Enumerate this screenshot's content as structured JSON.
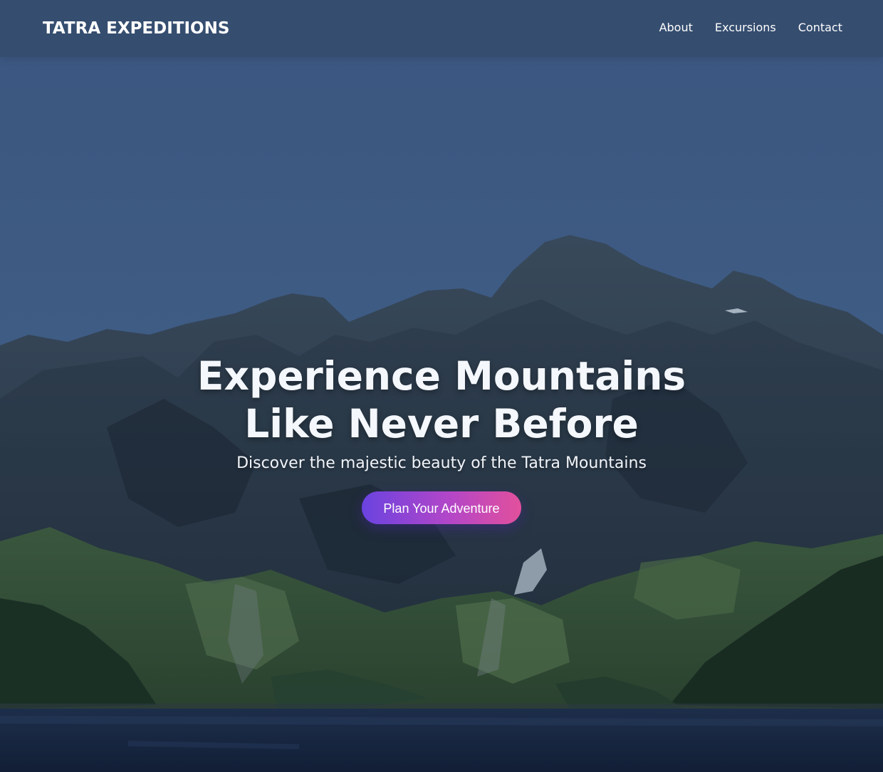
{
  "header": {
    "logo": "TATRA EXPEDITIONS",
    "nav": [
      {
        "label": "About"
      },
      {
        "label": "Excursions"
      },
      {
        "label": "Contact"
      }
    ]
  },
  "hero": {
    "headline_line1": "Experience Mountains",
    "headline_line2": "Like Never Before",
    "subtitle": "Discover the majestic beauty of the Tatra Mountains",
    "cta_label": "Plan Your Adventure",
    "background": "mountain-lake-landscape-photo"
  },
  "colors": {
    "sky": "#3f5d86",
    "navbar": "#344c6c",
    "cta_gradient_start": "#6a43e0",
    "cta_gradient_end": "#e2509c",
    "text": "#ffffff"
  }
}
